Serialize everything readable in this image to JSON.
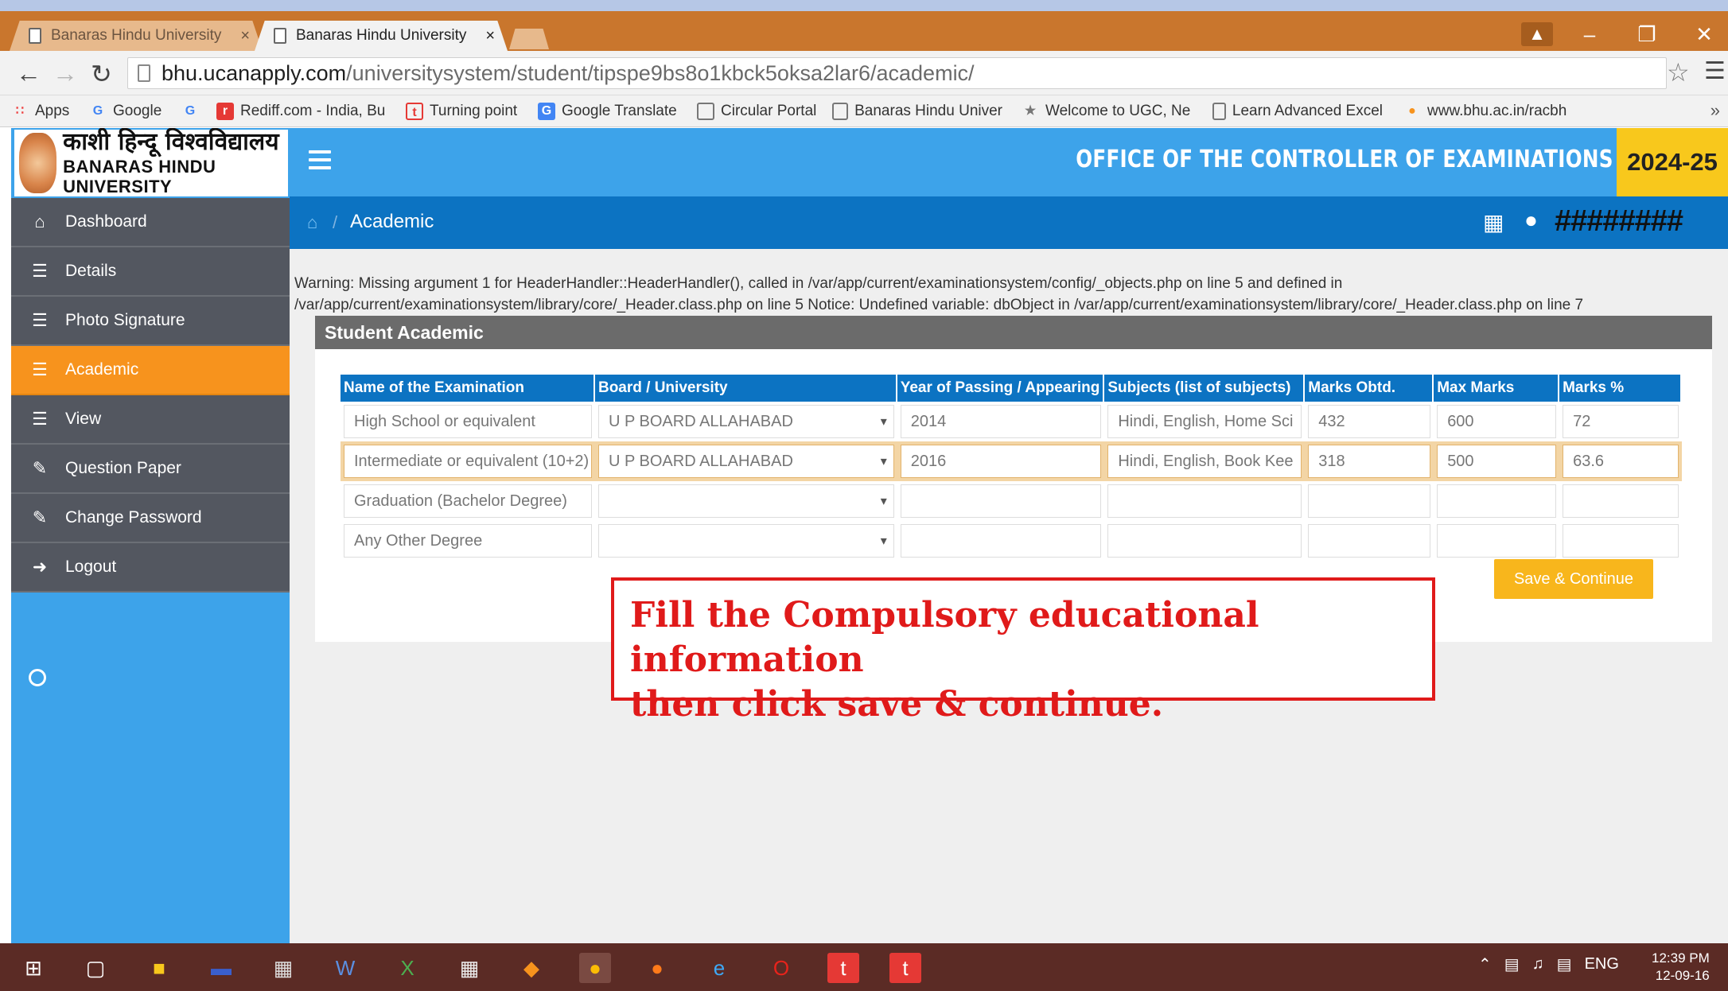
{
  "browser": {
    "tabs": [
      {
        "title": "Banaras Hindu University",
        "close": "×"
      },
      {
        "title": "Banaras Hindu University",
        "close": "×"
      }
    ],
    "url_host": "bhu.ucanapply.com",
    "url_path": "/universitysystem/student/tipspe9bs8o1kbck5oksa2lar6/academic/",
    "bookmarks": [
      "Apps",
      "Google",
      "Rediff.com - India, Bu",
      "Turning point",
      "Google Translate",
      "Circular Portal",
      "Banaras Hindu Univer",
      "Welcome to UGC, Ne",
      "Learn Advanced Excel",
      "www.bhu.ac.in/racbh"
    ]
  },
  "logo": {
    "hindi": "काशी हिन्दू विश्वविद्यालय",
    "english": "BANARAS HINDU UNIVERSITY"
  },
  "header": {
    "office_title": "OFFICE OF THE CONTROLLER OF EXAMINATIONS",
    "year": "2024-25"
  },
  "breadcrumb": {
    "current": "Academic",
    "user": "########"
  },
  "sidebar": {
    "items": [
      {
        "label": "Dashboard",
        "icon": "home-icon"
      },
      {
        "label": "Details",
        "icon": "list-icon"
      },
      {
        "label": "Photo Signature",
        "icon": "list-icon"
      },
      {
        "label": "Academic",
        "icon": "list-icon",
        "active": true
      },
      {
        "label": "View",
        "icon": "list-icon"
      },
      {
        "label": "Question Paper",
        "icon": "edit-icon"
      },
      {
        "label": "Change Password",
        "icon": "edit-icon"
      },
      {
        "label": "Logout",
        "icon": "logout-icon"
      }
    ]
  },
  "warning": "Warning: Missing argument 1 for HeaderHandler::HeaderHandler(), called in /var/app/current/examinationsystem/config/_objects.php on line 5 and defined in /var/app/current/examinationsystem/library/core/_Header.class.php on line 5 Notice: Undefined variable: dbObject in /var/app/current/examinationsystem/library/core/_Header.class.php on line 7",
  "panel": {
    "title": "Student Academic",
    "columns": [
      "Name of the Examination",
      "Board / University",
      "Year of Passing / Appearing",
      "Subjects (list of subjects)",
      "Marks Obtd.",
      "Max Marks",
      "Marks %"
    ],
    "rows": [
      {
        "exam": "High School or equivalent",
        "board": "U P BOARD ALLAHABAD",
        "year": "2014",
        "subjects": "Hindi, English, Home Sci",
        "marks": "432",
        "max": "600",
        "percent": "72"
      },
      {
        "exam": "Intermediate or equivalent (10+2)",
        "board": "U P BOARD ALLAHABAD",
        "year": "2016",
        "subjects": "Hindi, English, Book Kee",
        "marks": "318",
        "max": "500",
        "percent": "63.6"
      },
      {
        "exam": "Graduation (Bachelor Degree)",
        "board": "",
        "year": "",
        "subjects": "",
        "marks": "",
        "max": "",
        "percent": ""
      },
      {
        "exam": "Any Other Degree",
        "board": "",
        "year": "",
        "subjects": "",
        "marks": "",
        "max": "",
        "percent": ""
      }
    ],
    "save_label": "Save & Continue"
  },
  "instruction": {
    "line1": "Fill the Compulsory educational information",
    "line2": "then click save & continue."
  },
  "taskbar": {
    "lang": "ENG",
    "time": "12:39 PM",
    "date": "12-09-16"
  },
  "colors": {
    "header_blue": "#3da3ea",
    "breadcrumb_blue": "#0c73c2",
    "active_orange": "#f7931d",
    "save_button": "#f8b61c",
    "year_badge": "#f8c81c",
    "instruction_red": "#e01a1a"
  }
}
